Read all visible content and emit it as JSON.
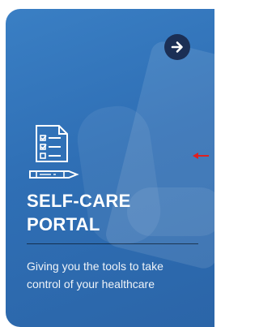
{
  "card": {
    "title_line1": "SELF-CARE",
    "title_line2": "PORTAL",
    "subtitle_line1": "Giving you the tools to take",
    "subtitle_line2": "control of your healthcare",
    "arrow_icon": "arrow-right-icon",
    "feature_icon": "checklist-document-pen-icon"
  },
  "colors": {
    "card_background": "#2f6fb5",
    "arrow_button": "#1b2f55",
    "pointer": "#e02020"
  }
}
